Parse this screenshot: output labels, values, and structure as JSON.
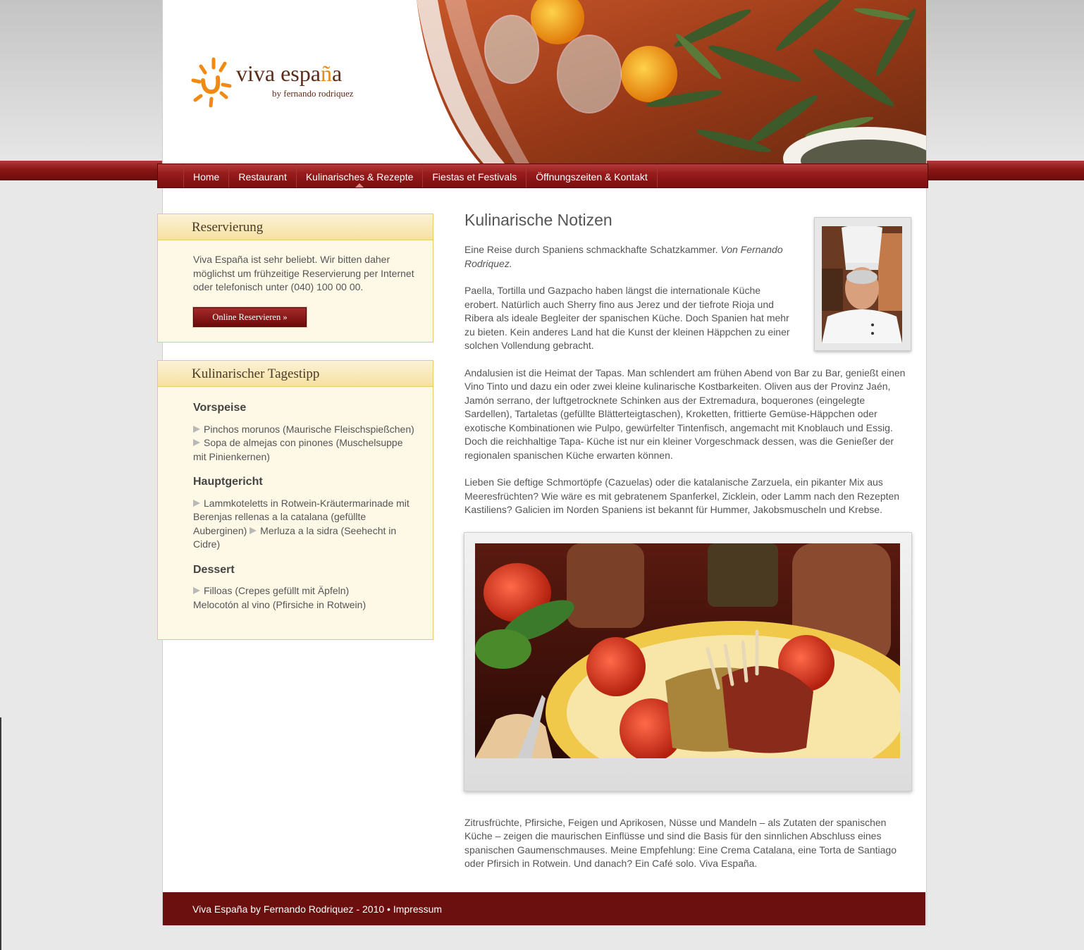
{
  "logo": {
    "name_main": "viva espa",
    "name_accent": "ñ",
    "name_end": "a",
    "byline": "by fernando rodriquez"
  },
  "nav": {
    "items": [
      {
        "label": "Home"
      },
      {
        "label": "Restaurant"
      },
      {
        "label": "Kulinarisches & Rezepte",
        "active": true
      },
      {
        "label": "Fiestas et Festivals"
      },
      {
        "label": "Öffnungszeiten & Kontakt"
      }
    ]
  },
  "reservation": {
    "title": "Reservierung",
    "text": "Viva España ist sehr beliebt. Wir bitten daher möglichst um frühzeitige Reservierung per Internet oder telefonisch unter (040) 100 00 00.",
    "button": "Online Reservieren »"
  },
  "tip": {
    "title": "Kulinarischer Tagestipp",
    "starter_title": "Vorspeise",
    "starter_1": "Pinchos morunos (Maurische Fleischspießchen)",
    "starter_2": "Sopa de almejas con pinones (Muschelsuppe mit Pinienkernen)",
    "main_title": "Hauptgericht",
    "main_1": "Lammkoteletts in Rotwein-Kräutermarinade mit Berenjas rellenas a la catalana (gefüllte Auberginen)",
    "main_2": "Merluza a la sidra (Seehecht in Cidre)",
    "dessert_title": "Dessert",
    "dessert_1": "Filloas (Crepes gefüllt mit Äpfeln)",
    "dessert_2": "Melocotón al vino (Pfirsiche in Rotwein)"
  },
  "article": {
    "title": "Kulinarische Notizen",
    "intro": "Eine Reise durch Spaniens schmackhafte Schatzkammer.",
    "intro_author": "Von Fernando Rodriquez.",
    "p1": "Paella, Tortilla und Gazpacho haben längst die internationale Küche erobert. Natürlich auch Sherry fino aus Jerez und der tiefrote Rioja und Ribera als ideale Begleiter der spanischen Küche. Doch Spanien hat mehr zu bieten. Kein anderes Land hat die Kunst der kleinen Häppchen zu einer solchen Vollendung gebracht.",
    "p2": "Andalusien ist die Heimat der Tapas. Man schlendert am frühen Abend von Bar zu Bar, genießt einen Vino Tinto und dazu ein oder zwei kleine kulinarische Kostbarkeiten. Oliven aus der Provinz Jaén, Jamón serrano, der luftgetrocknete Schinken aus der Extremadura, boquerones (eingelegte Sardellen), Tartaletas (gefüllte Blätterteigtaschen), Kroketten, frittierte Gemüse-Häppchen oder exotische Kombinationen wie Pulpo, gewürfelter Tintenfisch, angemacht mit Knoblauch und Essig. Doch die reichhaltige Tapa- Küche ist nur ein kleiner Vorgeschmack dessen, was die Genießer der regionalen spanischen Küche erwarten können.",
    "p3": "Lieben Sie deftige Schmortöpfe (Cazuelas) oder die katalanische Zarzuela, ein pikanter Mix aus Meeresfrüchten? Wie wäre es mit gebratenem Spanferkel, Zicklein, oder Lamm nach den Rezepten Kastiliens? Galicien im Norden Spaniens ist bekannt für Hummer, Jakobsmuscheln und Krebse.",
    "p4": "Zitrusfrüchte, Pfirsiche, Feigen und Aprikosen, Nüsse und Mandeln – als Zutaten der spanischen Küche – zeigen die maurischen Einflüsse und sind die Basis für den sinnlichen Abschluss eines spanischen Gaumenschmauses. Meine Empfehlung: Eine Crema Catalana, eine Torta de Santiago oder Pfirsich in Rotwein. Und danach? Ein Café solo. Viva España."
  },
  "footer": {
    "text": "Viva España by Fernando Rodriquez - 2010 •",
    "link": "Impressum"
  },
  "colors": {
    "brand_red": "#7a0f0f",
    "accent_orange": "#e88a16",
    "box_bg": "#fef8e7",
    "box_border": "#e8c970"
  }
}
